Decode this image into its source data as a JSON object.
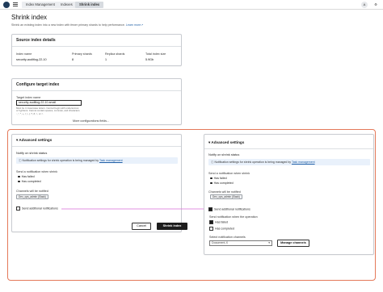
{
  "topbar": {
    "breadcrumbs": [
      "Index Management",
      "Indexes",
      "Shrink index"
    ]
  },
  "header": {
    "title": "Shrink index",
    "subtitle": "Shrink an existing index into a new index with fewer primary shards to help performance.",
    "learn_more": "Learn more"
  },
  "source": {
    "title": "Source index details",
    "columns": [
      {
        "header": "Index name",
        "value": "security-auditlog-22-10"
      },
      {
        "header": "Primary shards",
        "value": "8"
      },
      {
        "header": "Replica shards",
        "value": "1"
      },
      {
        "header": "Total index size",
        "value": "5.9Gb"
      }
    ]
  },
  "target": {
    "title": "Configure target index",
    "name_label": "Target index name",
    "name_value": "security-auditlog-22-10-small",
    "hint": "Must be in lowercase letters. Cannot begin with underscores or hyphens. Cannot contain spaces, commas, and characters :, \", *, +, /, \\, |, ?, #, >, or <.",
    "more_link": "More configurations fields..."
  },
  "advanced_left": {
    "title": "Advanced settings",
    "notify_heading": "Notify on shrink status",
    "info_text": "Notification settings for shrink operation is being managed by",
    "info_link": "Task management",
    "send_label": "Send a notification when shrink",
    "radio1": "Has failed",
    "radio2": "Has completed",
    "channels_label": "Channels will be notified",
    "channel_token": "Dev_ops_admin (Slack)",
    "checkbox_label": "Send additional notifications"
  },
  "advanced_right": {
    "title": "Advanced settings",
    "notify_heading": "Notify on shrink status",
    "info_text": "Notification settings for shrink operation is being managed by",
    "info_link": "Task management",
    "send_label": "Send a notification when shrink",
    "radio1": "Has failed",
    "radio2": "Has completed",
    "channels_label": "Channels will be notified",
    "channel_token": "Dev_ops_admin (Slack)",
    "checkbox_label": "Send additional notifications",
    "op_label": "Send notification when the operation",
    "op_cb1": "Has failed",
    "op_cb2": "Has completed",
    "select_label": "Select notification channels",
    "select_value": "Document-X",
    "manage_button": "Manage channels"
  },
  "actions": {
    "cancel": "Cancel",
    "submit": "Shrink index"
  },
  "colors": {
    "highlight_border": "#e4795a",
    "connector": "#d96bd6",
    "primary_button": "#1d1d1d"
  }
}
